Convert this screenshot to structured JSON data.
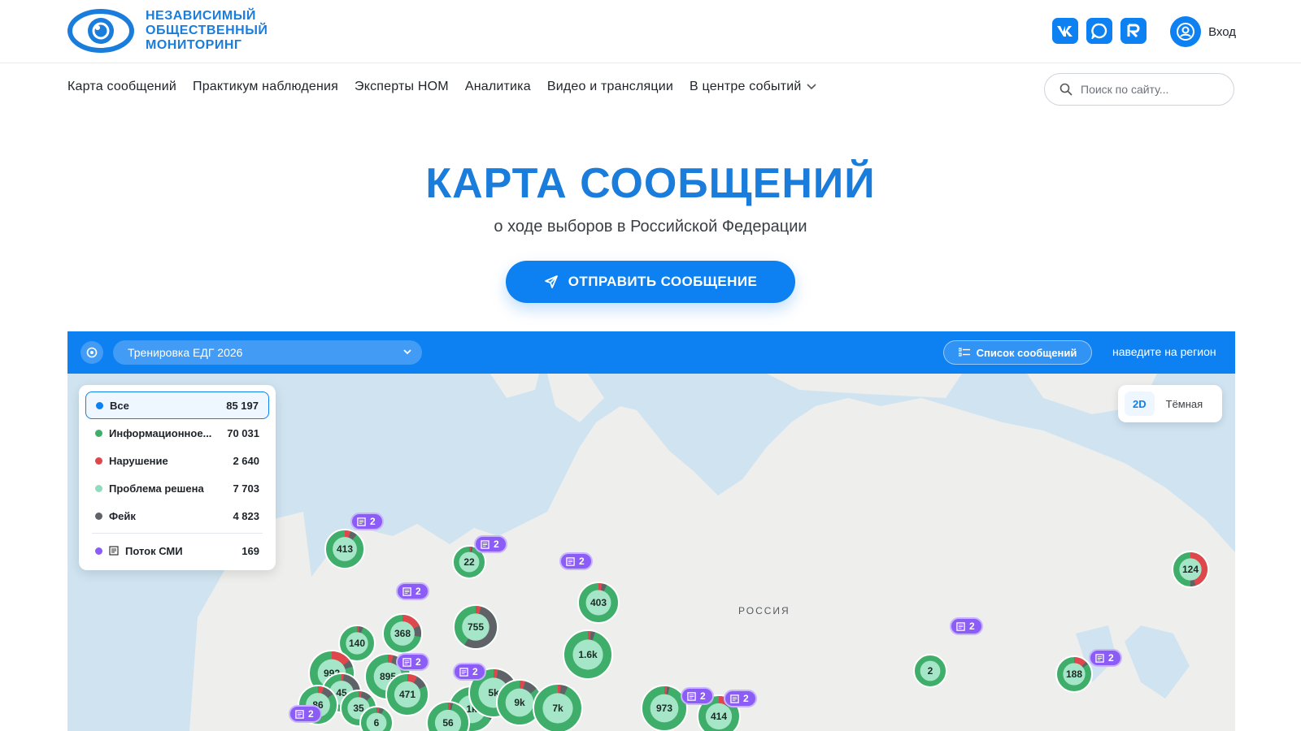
{
  "brand": {
    "line1": "НЕЗАВИСИМЫЙ",
    "line2": "ОБЩЕСТВЕННЫЙ",
    "line3": "МОНИТОРИНГ"
  },
  "header": {
    "login_label": "Вход",
    "socials": [
      "vk-icon",
      "max-icon",
      "rutube-icon"
    ]
  },
  "nav": {
    "items": [
      "Карта сообщений",
      "Практикум наблюдения",
      "Эксперты НОМ",
      "Аналитика",
      "Видео и трансляции",
      "В центре событий"
    ],
    "search_placeholder": "Поиск по сайту..."
  },
  "hero": {
    "title": "КАРТА СООБЩЕНИЙ",
    "subtitle": "о ходе выборов в Российской Федерации",
    "send_button": "ОТПРАВИТЬ СООБЩЕНИЕ"
  },
  "map": {
    "election": "Тренировка ЕДГ 2026",
    "list_button": "Список сообщений",
    "hover_hint": "наведите на регион",
    "region_label": "РОССИЯ",
    "view_modes": [
      "2D",
      "Тёмная"
    ],
    "legend": [
      {
        "label": "Все",
        "value": "85 197",
        "color": "#0d80f2"
      },
      {
        "label": "Информационное...",
        "value": "70 031",
        "color": "#3fae6a"
      },
      {
        "label": "Нарушение",
        "value": "2 640",
        "color": "#e0474c"
      },
      {
        "label": "Проблема решена",
        "value": "7 703",
        "color": "#8fdcbf"
      },
      {
        "label": "Фейк",
        "value": "4 823",
        "color": "#5f6368"
      }
    ],
    "media_stream": {
      "label": "Поток СМИ",
      "value": "169",
      "color": "#8b5cf6"
    },
    "clusters": [
      "413",
      "22",
      "403",
      "755",
      "368",
      "140",
      "1.6k",
      "2",
      "188",
      "124",
      "992",
      "45",
      "86",
      "35",
      "895",
      "471",
      "1k",
      "5k",
      "973",
      "414",
      "6",
      "56",
      "9k",
      "7k"
    ],
    "media_badges": [
      "2",
      "2",
      "2",
      "2",
      "2",
      "2",
      "2",
      "2",
      "2",
      "2",
      "2"
    ]
  }
}
